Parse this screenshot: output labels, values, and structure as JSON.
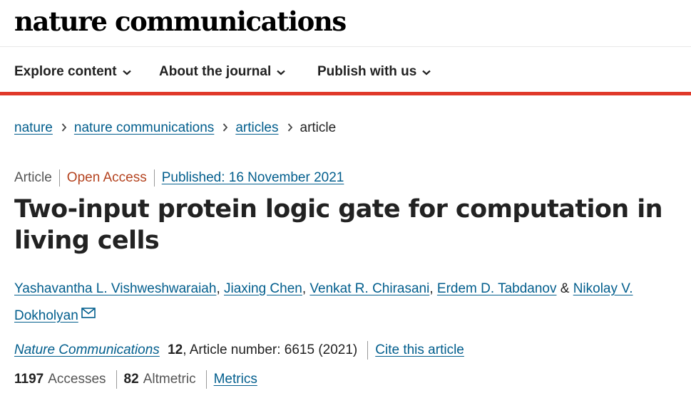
{
  "header": {
    "logo": "nature communications",
    "nav": [
      {
        "label": "Explore content"
      },
      {
        "label": "About the journal"
      },
      {
        "label": "Publish with us"
      }
    ]
  },
  "breadcrumb": [
    "nature",
    "nature communications",
    "articles",
    "article"
  ],
  "article": {
    "type": "Article",
    "access": "Open Access",
    "published": "Published: 16 November 2021",
    "title": "Two-input protein logic gate for computation in living cells",
    "authors": [
      "Yashavantha L. Vishweshwaraiah",
      "Jiaxing Chen",
      "Venkat R. Chirasani",
      "Erdem D. Tabdanov",
      "Nikolay V. Dokholyan"
    ],
    "citation": {
      "journal": "Nature Communications",
      "volume": "12",
      "rest": ", Article number: 6615 (2021)",
      "cite_link": "Cite this article"
    },
    "metrics": {
      "accesses_value": "1197",
      "accesses_label": "Accesses",
      "altmetric_value": "82",
      "altmetric_label": "Altmetric",
      "metrics_link": "Metrics"
    }
  },
  "colors": {
    "link": "#025e8d",
    "accent_bar": "#e0392a",
    "open_access": "#b4431f"
  }
}
